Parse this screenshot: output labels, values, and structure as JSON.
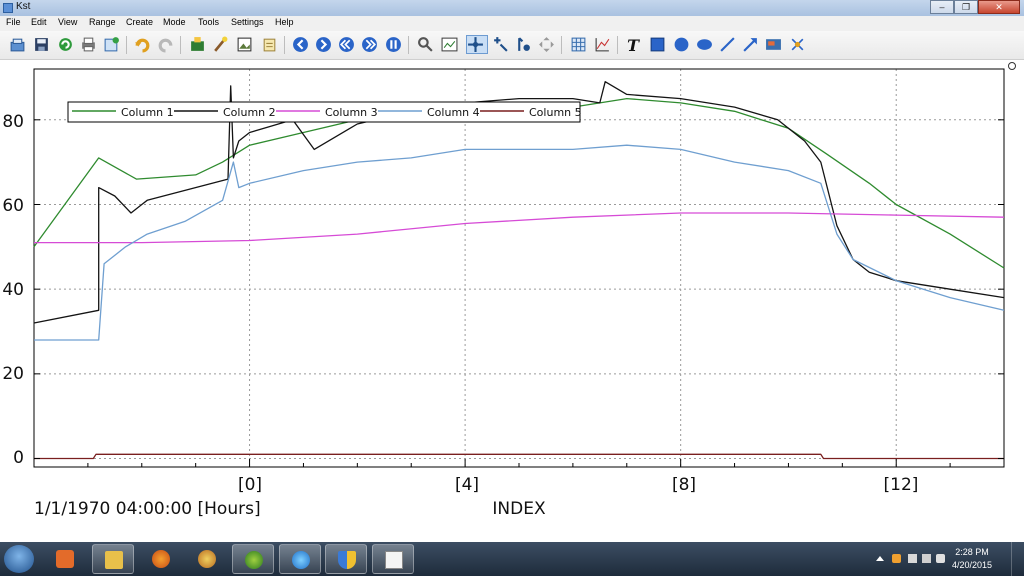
{
  "window": {
    "title": "Kst"
  },
  "window_buttons": [
    "minimize",
    "maximize",
    "close"
  ],
  "menu": [
    "File",
    "Edit",
    "View",
    "Range",
    "Create",
    "Mode",
    "Tools",
    "Settings",
    "Help"
  ],
  "toolbar_icons": [
    "open-icon",
    "save-icon",
    "reload-icon",
    "print-icon",
    "export-icon",
    "undo-icon",
    "redo-icon",
    "data-manager-icon",
    "wizard-icon",
    "image-icon",
    "edit-icon",
    "back-icon",
    "forward-icon",
    "rewind-icon",
    "fast-forward-icon",
    "pause-icon",
    "zoom-icon",
    "layout-icon",
    "pan-icon",
    "cursor-icon",
    "tied-zoom-icon",
    "move-icon",
    "grid-icon",
    "plot-icon",
    "label-icon",
    "box-icon",
    "circle-icon",
    "ellipse-icon",
    "line-icon",
    "arrow-icon",
    "picture-icon",
    "svg-icon"
  ],
  "plot": {
    "x_tick_labels": [
      "[0]",
      "[4]",
      "[8]",
      "[12]"
    ],
    "y_tick_labels": [
      "0",
      "20",
      "40",
      "60",
      "80"
    ],
    "xlabel": "INDEX",
    "x_date_label": "1/1/1970 04:00:00 [Hours]",
    "legend": [
      "Column 1",
      "Column 2",
      "Column 3",
      "Column 4",
      "Column 5"
    ]
  },
  "colors": {
    "column1": "#2f8b2f",
    "column2": "#141414",
    "column3": "#d64bd6",
    "column4": "#6f9fd0",
    "column5": "#7a1f1f",
    "grid": "#9a9a9a"
  },
  "chart_data": {
    "type": "line",
    "xlabel": "INDEX",
    "ylabel": "",
    "xlim": [
      -4,
      14
    ],
    "ylim": [
      -2,
      92
    ],
    "x_ticks": [
      0,
      4,
      8,
      12
    ],
    "y_ticks": [
      0,
      20,
      40,
      60,
      80
    ],
    "grid": true,
    "legend_position": "top-left",
    "series": [
      {
        "name": "Column 1",
        "x": [
          -4,
          -2.8,
          -2.1,
          -1.0,
          -0.5,
          0,
          1,
          2,
          4,
          6,
          7,
          8,
          9,
          10,
          10.7,
          11.5,
          12,
          13,
          14
        ],
        "y": [
          50,
          71,
          66,
          67,
          70,
          74,
          77,
          80,
          82,
          83,
          85,
          84,
          82,
          78,
          72,
          65,
          60,
          53,
          45
        ]
      },
      {
        "name": "Column 2",
        "x": [
          -4,
          -2.8,
          -2.8,
          -2.5,
          -2.2,
          -2.0,
          -1.9,
          -0.4,
          -0.35,
          -0.3,
          -0.2,
          0,
          0.8,
          1.2,
          2,
          3,
          4,
          5,
          6,
          6.5,
          6.6,
          7,
          8,
          9,
          9.8,
          10.3,
          10.6,
          10.9,
          11.2,
          11.5,
          12,
          13,
          14
        ],
        "y": [
          32,
          35,
          64,
          62,
          58,
          60,
          61,
          66,
          88,
          71,
          75,
          77,
          80,
          73,
          79,
          82,
          84,
          85,
          85,
          84,
          89,
          86,
          85,
          83,
          80,
          75,
          70,
          55,
          47,
          44,
          42,
          40,
          38
        ]
      },
      {
        "name": "Column 3",
        "x": [
          -4,
          -2,
          0,
          2,
          4,
          6,
          8,
          10,
          12,
          14
        ],
        "y": [
          51,
          51,
          51.5,
          53,
          55.5,
          57,
          58,
          58,
          57.5,
          57
        ]
      },
      {
        "name": "Column 4",
        "x": [
          -4,
          -2.8,
          -2.7,
          -2.3,
          -1.9,
          -1.2,
          -0.5,
          -0.3,
          -0.2,
          0,
          1,
          2,
          3,
          4,
          5,
          6,
          7,
          8,
          9,
          10,
          10.6,
          10.9,
          11.2,
          12,
          13,
          14
        ],
        "y": [
          28,
          28,
          46,
          50,
          53,
          56,
          61,
          70,
          64,
          65,
          68,
          70,
          71,
          73,
          73,
          73,
          74,
          73,
          70,
          68,
          65,
          53,
          47,
          42,
          38,
          35
        ]
      },
      {
        "name": "Column 5",
        "x": [
          -4,
          -2.9,
          -2.85,
          -0.25,
          10.6,
          10.65,
          14
        ],
        "y": [
          0,
          0,
          1,
          1,
          1,
          0,
          0
        ]
      }
    ]
  },
  "taskbar": {
    "items": [
      {
        "name": "media-player-icon",
        "state": "pinned"
      },
      {
        "name": "file-explorer-icon",
        "state": "open"
      },
      {
        "name": "firefox-icon",
        "state": "pinned"
      },
      {
        "name": "paint-icon",
        "state": "pinned"
      },
      {
        "name": "green-app-icon",
        "state": "open"
      },
      {
        "name": "internet-explorer-icon",
        "state": "open"
      },
      {
        "name": "shield-icon",
        "state": "open"
      },
      {
        "name": "kst-window-icon",
        "state": "open"
      }
    ],
    "time": "2:28 PM",
    "date": "4/20/2015"
  }
}
